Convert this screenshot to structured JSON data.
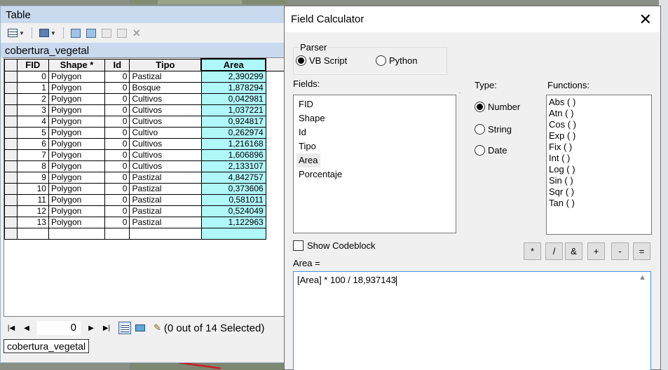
{
  "table_window": {
    "title": "Table",
    "layer_name": "cobertura_vegetal",
    "columns": [
      "FID",
      "Shape *",
      "Id",
      "Tipo",
      "Area"
    ],
    "rows": [
      [
        "0",
        "Polygon",
        "0",
        "Pastizal",
        "2,390299"
      ],
      [
        "1",
        "Polygon",
        "0",
        "Bosque",
        "1,878294"
      ],
      [
        "2",
        "Polygon",
        "0",
        "Cultivos",
        "0,042981"
      ],
      [
        "3",
        "Polygon",
        "0",
        "Cultivos",
        "1,037221"
      ],
      [
        "4",
        "Polygon",
        "0",
        "Cultivos",
        "0,924817"
      ],
      [
        "5",
        "Polygon",
        "0",
        "Cultivo",
        "0,262974"
      ],
      [
        "6",
        "Polygon",
        "0",
        "Cultivos",
        "1,216168"
      ],
      [
        "7",
        "Polygon",
        "0",
        "Cultivos",
        "1,606896"
      ],
      [
        "8",
        "Polygon",
        "0",
        "Cultivos",
        "2,133107"
      ],
      [
        "9",
        "Polygon",
        "0",
        "Pastizal",
        "4,842757"
      ],
      [
        "10",
        "Polygon",
        "0",
        "Pastizal",
        "0,373606"
      ],
      [
        "11",
        "Polygon",
        "0",
        "Pastizal",
        "0,581011"
      ],
      [
        "12",
        "Polygon",
        "0",
        "Pastizal",
        "0,524049"
      ],
      [
        "13",
        "Polygon",
        "0",
        "Pastizal",
        "1,122963"
      ]
    ],
    "record_index": "0",
    "selection_status": "(0 out of 14 Selected)",
    "tab_label": "cobertura_vegetal",
    "area_column_color": "#aff7f9"
  },
  "dialog": {
    "title": "Field Calculator",
    "parser_label": "Parser",
    "parser_options": [
      {
        "label": "VB Script",
        "selected": true
      },
      {
        "label": "Python",
        "selected": false
      }
    ],
    "fields_label": "Fields:",
    "fields": [
      "FID",
      "Shape",
      "Id",
      "Tipo",
      "Area",
      "Porcentaje"
    ],
    "type_label": "Type:",
    "types": [
      {
        "label": "Number",
        "selected": true
      },
      {
        "label": "String",
        "selected": false
      },
      {
        "label": "Date",
        "selected": false
      }
    ],
    "functions_label": "Functions:",
    "functions": [
      "Abs ( )",
      "Atn ( )",
      "Cos ( )",
      "Exp ( )",
      "Fix ( )",
      "Int ( )",
      "Log ( )",
      "Sin ( )",
      "Sqr ( )",
      "Tan ( )"
    ],
    "show_codeblock": "Show Codeblock",
    "operators": [
      "*",
      "/",
      "&",
      "+",
      "-",
      "="
    ],
    "expression_label": "Area =",
    "expression": "[Area] * 100 / 18,937143"
  }
}
